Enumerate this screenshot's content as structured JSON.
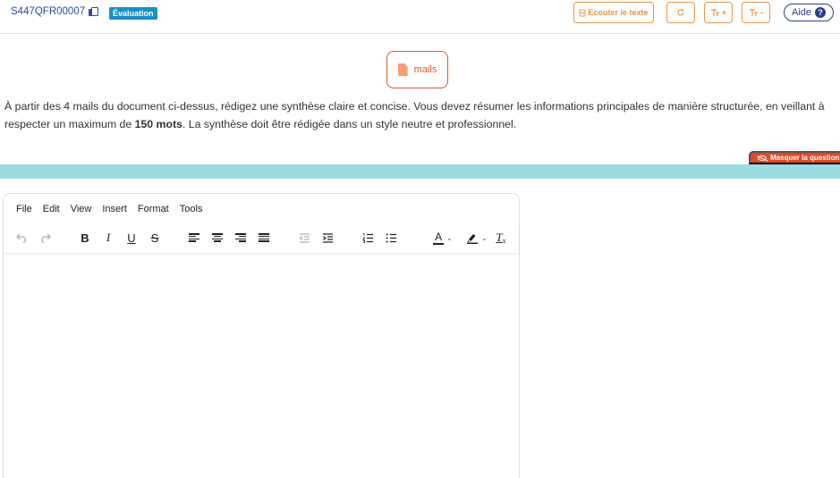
{
  "header": {
    "question_id": "S447QFR00007",
    "badge": "Évaluation",
    "listen_label": "Ecouter le texte",
    "font_plus_label": "+",
    "font_minus_label": "-",
    "help_label": "Aide",
    "help_icon": "?"
  },
  "document": {
    "label": "mails"
  },
  "instructions": {
    "part1": "À partir des 4 mails du document ci-dessus, rédigez une synthèse claire et concise. Vous devez résumer les informations principales de manière structurée, en veillant à respecter un maximum de ",
    "bold": "150 mots",
    "part2": ". La synthèse doit être rédigée dans un style neutre et professionnel."
  },
  "hide_question_label": "Masquer la question",
  "editor": {
    "menu": [
      "File",
      "Edit",
      "View",
      "Insert",
      "Format",
      "Tools"
    ],
    "toolbar_icons": [
      "undo-icon",
      "redo-icon",
      "bold-icon",
      "italic-icon",
      "underline-icon",
      "strikethrough-icon",
      "align-left-icon",
      "align-center-icon",
      "align-right-icon",
      "align-justify-icon",
      "outdent-icon",
      "indent-icon",
      "numbered-list-icon",
      "bullet-list-icon",
      "text-color-icon",
      "highlight-icon",
      "clear-format-icon"
    ],
    "glyphs": {
      "bold": "B",
      "italic": "I",
      "underline": "U",
      "strike": "S",
      "text_color": "A",
      "clear": "T"
    },
    "content": ""
  },
  "colors": {
    "accent_orange": "#e8944e",
    "danger_orange": "#e04a25",
    "navy": "#2a3e8c",
    "badge_blue": "#1a8fc9",
    "teal_band": "#9bdce3"
  }
}
